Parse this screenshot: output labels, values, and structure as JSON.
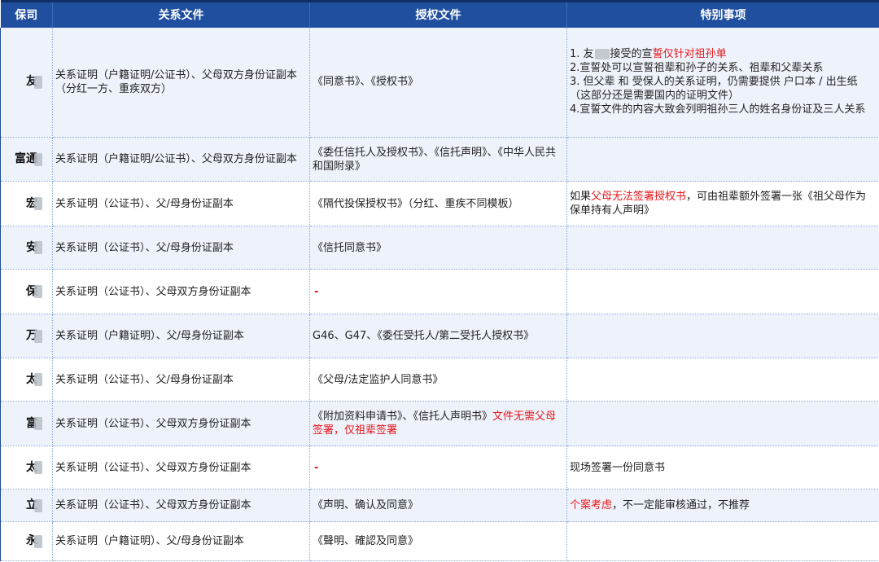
{
  "headers": {
    "insurer": "保司",
    "relation": "关系文件",
    "auth": "授权文件",
    "special": "特别事项"
  },
  "rows": [
    {
      "insurer": "友",
      "relation": "关系证明（户籍证明/公证书）、父母双方身份证副本（分红一方、重疾双方）",
      "auth": "《同意书》、《授权书》",
      "special": {
        "l1a": "1. 友",
        "l1b": "接受的宣",
        "l1c": "誓仅针对祖孙单",
        "l2": "2.宣誓处可以宣誓祖辈和孙子的关系、祖辈和父辈关系",
        "l3": "3. 但父辈 和 受保人的关系证明，仍需要提供 户口本 / 出生纸（这部分还是需要国内的证明文件）",
        "l4": "4.宣誓文件的内容大致会列明祖孙三人的姓名身份证及三人关系"
      }
    },
    {
      "insurer": "富通",
      "relation": "关系证明（户籍证明/公证书）、父母双方身份证副本",
      "auth": "《委任信托人及授权书》、《信托声明》、《中华人民共和国附录》"
    },
    {
      "insurer": "宏",
      "relation": "关系证明（公证书）、父/母身份证副本",
      "auth": "《隔代投保授权书》（分红、重疾不同模板）",
      "special": {
        "a": "如果",
        "b": "父母无法签署授权书",
        "c": "，可由祖辈额外签署一张《祖父母作为保单持有人声明》"
      }
    },
    {
      "insurer": "安",
      "relation": "关系证明（公证书）、父/母身份证副本",
      "auth": "《信托同意书》"
    },
    {
      "insurer": "保",
      "relation": "关系证明（公证书）、父母双方身份证副本",
      "auth_dash": "-"
    },
    {
      "insurer": "万",
      "relation": "关系证明（户籍证明）、父/母身份证副本",
      "auth": "G46、G47、《委任受托人/第二受托人授权书》"
    },
    {
      "insurer": "太",
      "relation": "关系证明（公证书）、父/母身份证副本",
      "auth": "《父母/法定监护人同意书》"
    },
    {
      "insurer": "富",
      "relation": "关系证明（公证书）、父母双方身份证副本",
      "auth": "《附加资料申请书》、《信托人声明书》",
      "auth_red": "文件无需父母签署，仅祖辈签署"
    },
    {
      "insurer": "太",
      "relation": "关系证明（公证书）、父母双方身份证副本",
      "auth_dash": "-",
      "special": "现场签署一份同意书"
    },
    {
      "insurer": "立",
      "relation": "关系证明（公证书）、父母双方身份证副本",
      "auth": "《声明、确认及同意》",
      "special": {
        "a": "个案考虑",
        "b": "，不一定能审核通过，不推荐"
      }
    },
    {
      "insurer": "永",
      "relation": "关系证明（户籍证明）、父/母身份证副本",
      "auth": "《聲明、確認及同意》"
    }
  ]
}
